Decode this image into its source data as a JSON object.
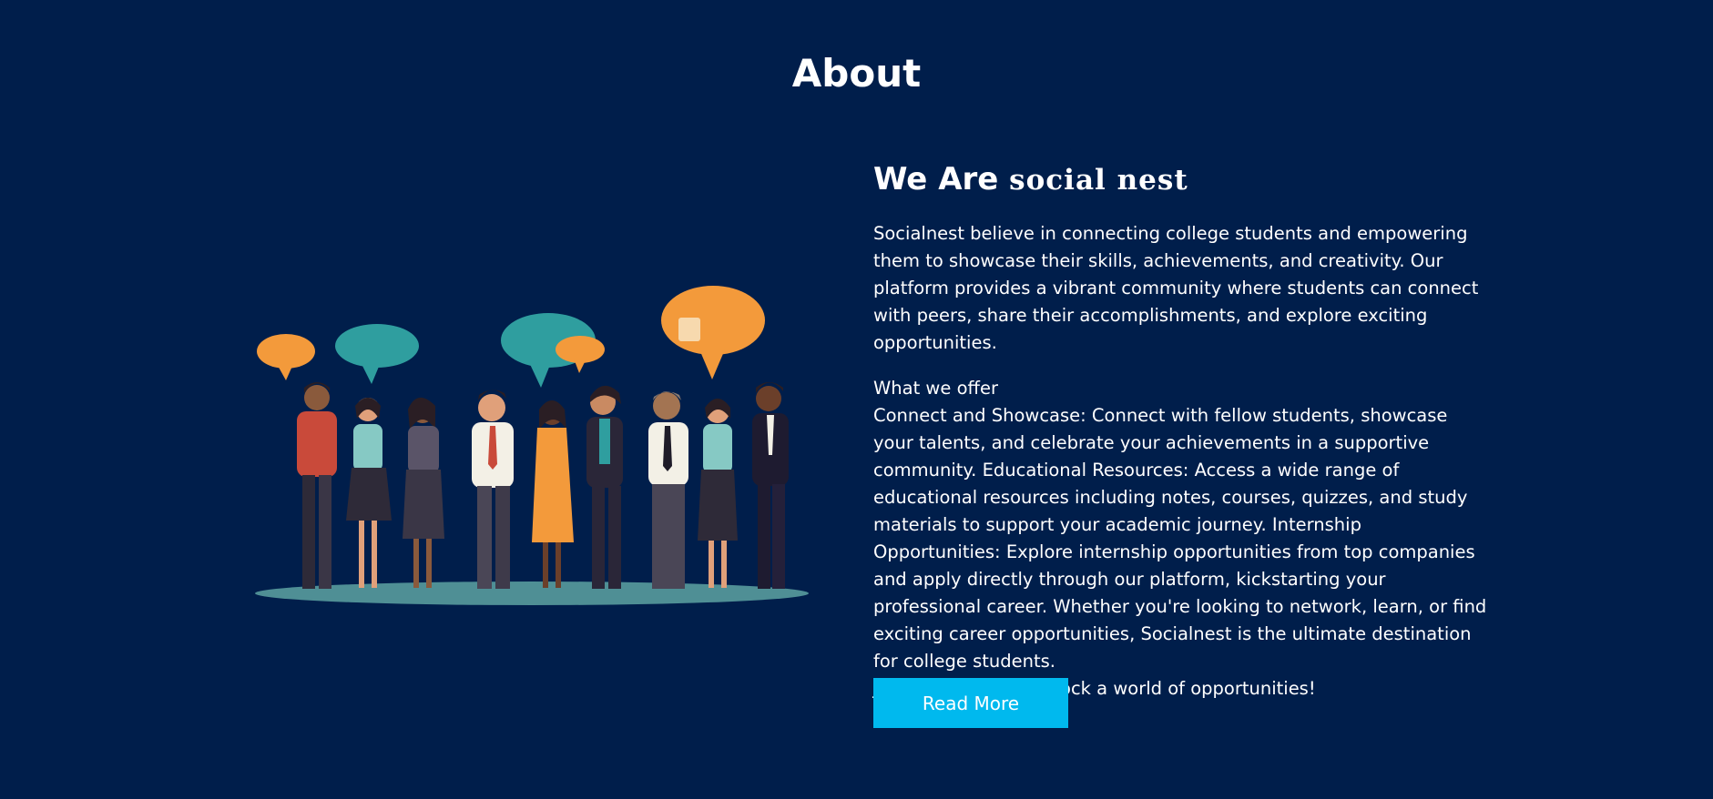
{
  "section": {
    "title": "About"
  },
  "about": {
    "heading_prefix": "We Are",
    "heading_brand": "social nest",
    "intro": "Socialnest believe in connecting college students and empowering them to showcase their skills, achievements, and creativity. Our platform provides a vibrant community where students can connect with peers, share their accomplishments, and explore exciting opportunities.",
    "offer_title": "What we offer",
    "offer_text": "Connect and Showcase: Connect with fellow students, showcase your talents, and celebrate your achievements in a supportive community. Educational Resources: Access a wide range of educational resources including notes, courses, quizzes, and study materials to support your academic journey. Internship Opportunities: Explore internship opportunities from top companies and apply directly through our platform, kickstarting your professional career. Whether you're looking to network, learn, or find exciting career opportunities, Socialnest is the ultimate destination for college students.",
    "closing": "Join us today and unlock a world of opportunities!",
    "read_more_label": "Read More"
  },
  "colors": {
    "background": "#001e4b",
    "button": "#00b9ee",
    "text": "#ffffff",
    "bubble_orange": "#f39a3b",
    "bubble_teal": "#2f9e9f"
  },
  "illustration": {
    "icon": "people-talking-illustration"
  }
}
